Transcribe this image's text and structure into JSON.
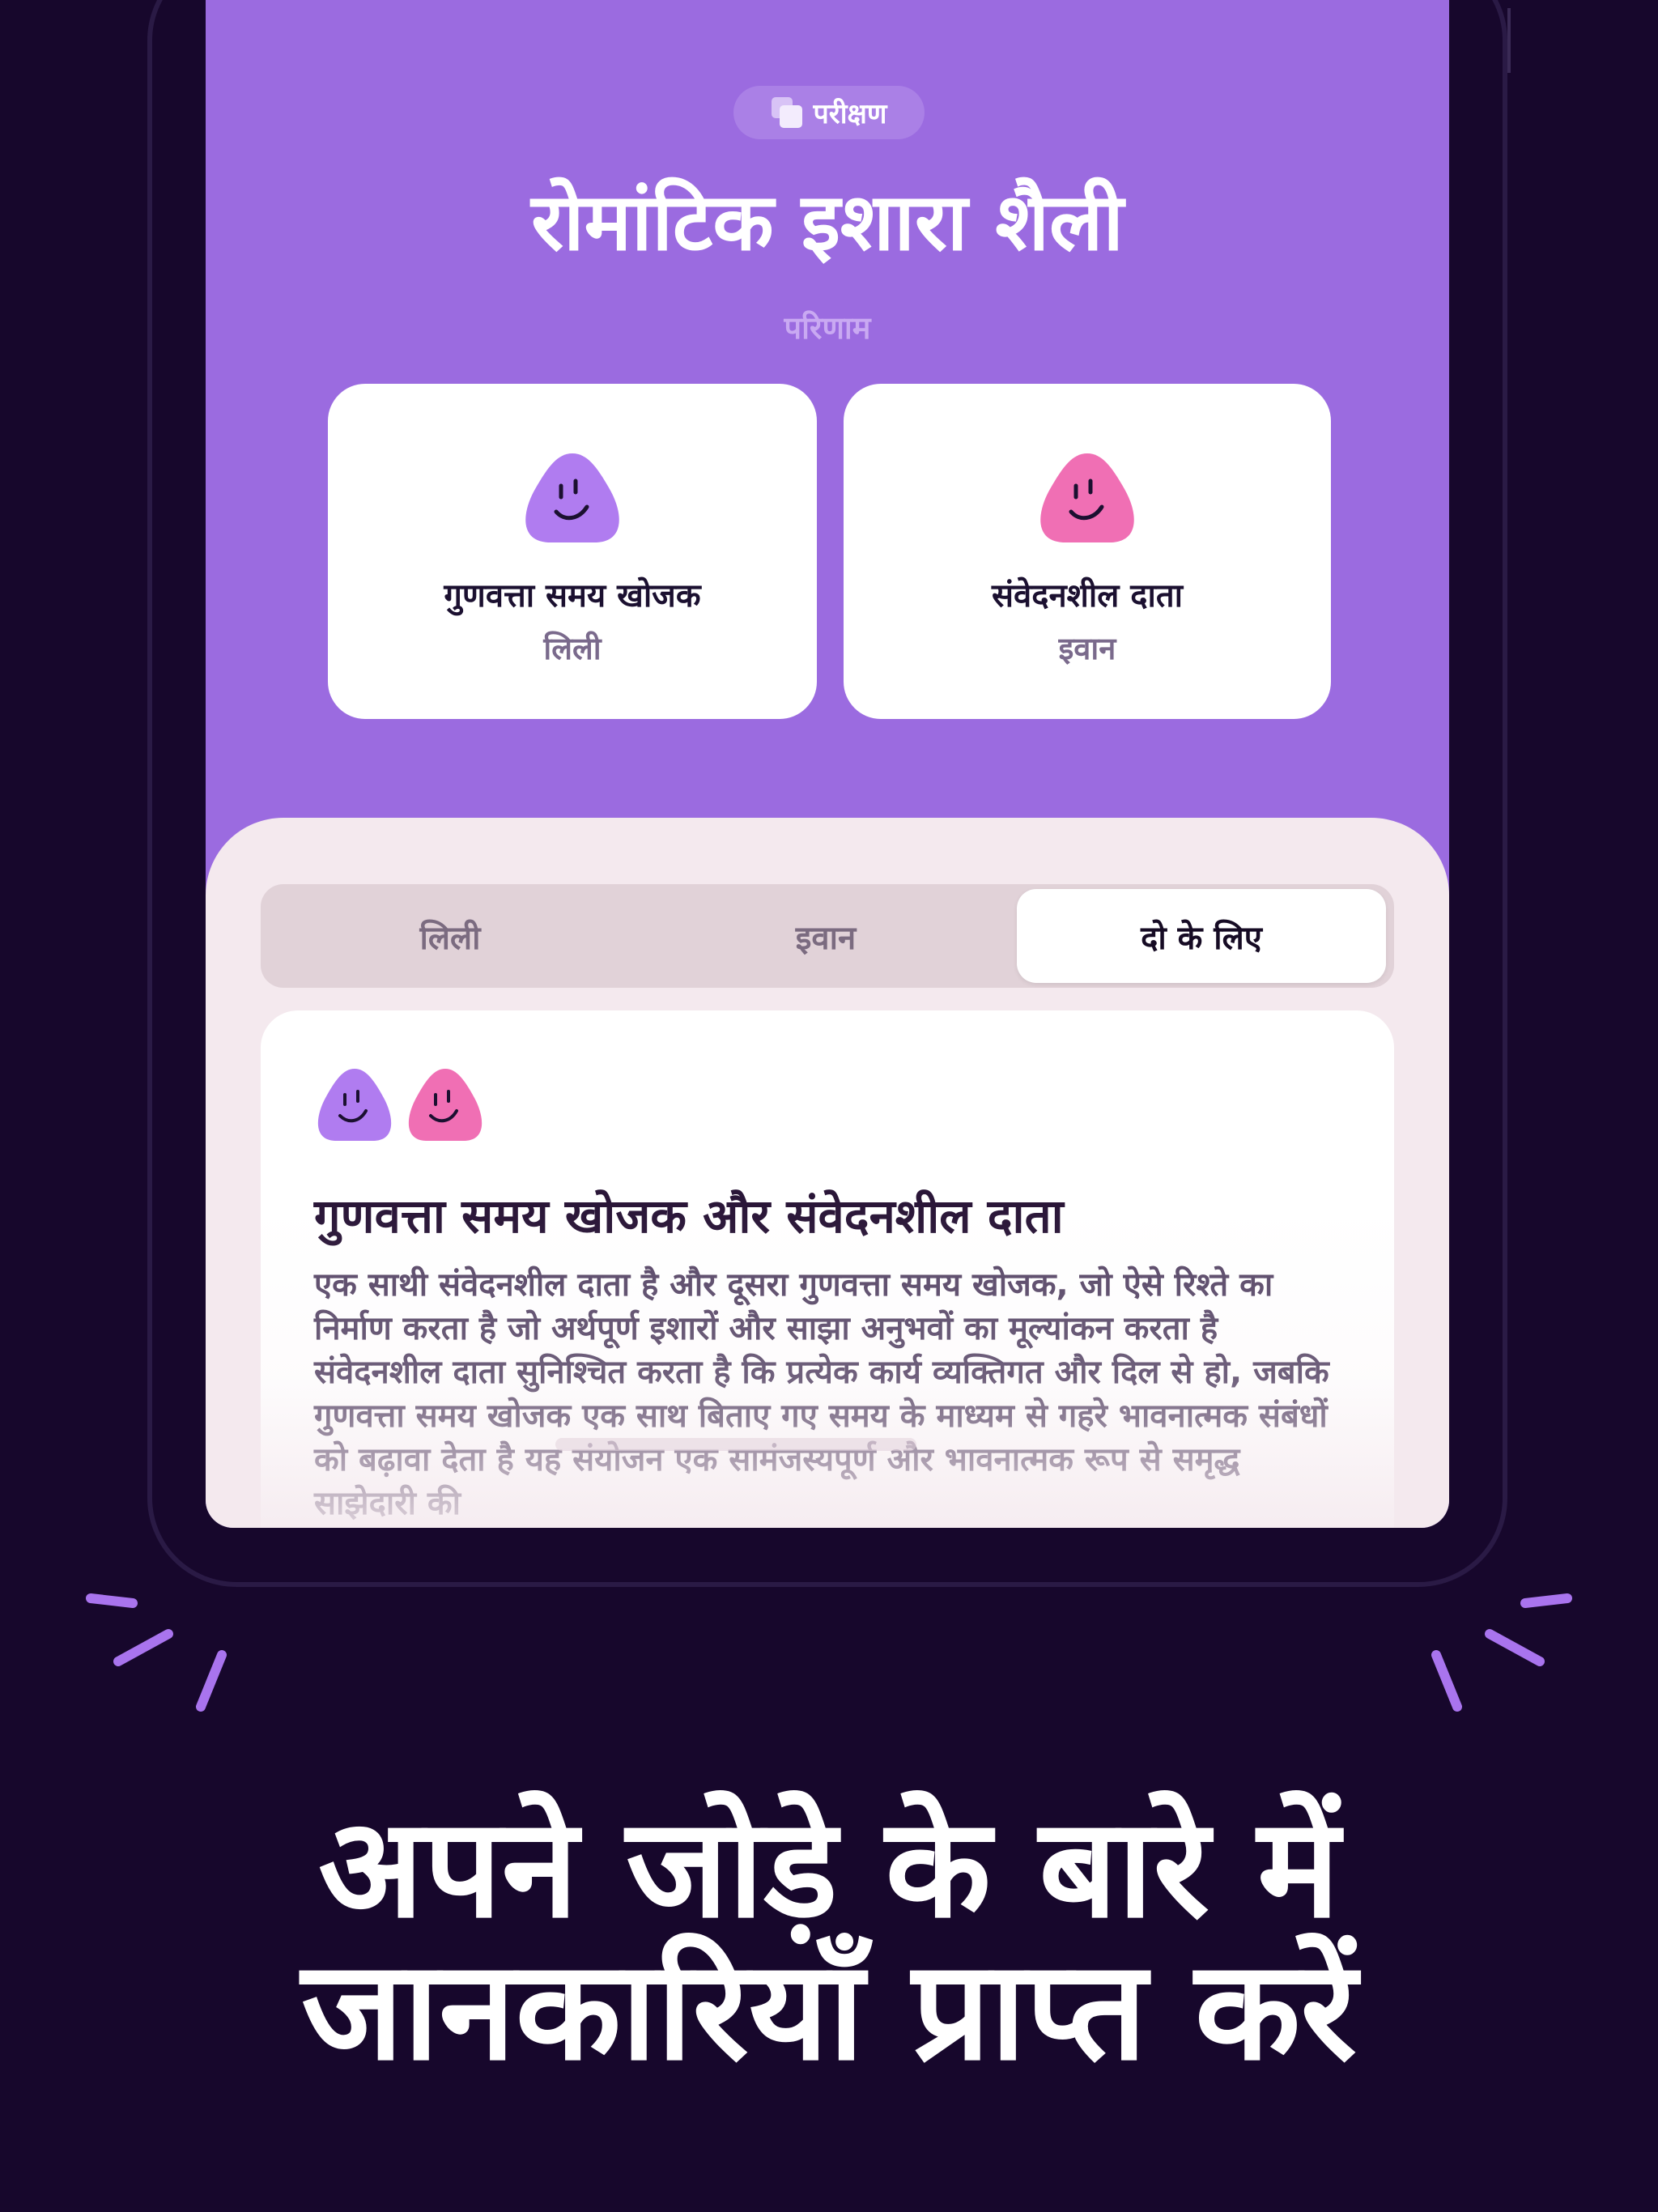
{
  "quiz": {
    "badge_label": "परीक्षण",
    "title": "रोमांटिक इशारा शैली",
    "results_label": "परिणाम"
  },
  "results": [
    {
      "type": "गुणवत्ता समय खोजक",
      "person": "लिली",
      "blob_color": "#b07cf0"
    },
    {
      "type": "संवेदनशील दाता",
      "person": "इवान",
      "blob_color": "#f06fb4"
    }
  ],
  "tabs": [
    {
      "label": "लिली",
      "selected": false
    },
    {
      "label": "इवान",
      "selected": false
    },
    {
      "label": "दो के लिए",
      "selected": true
    }
  ],
  "detail": {
    "title": "गुणवत्ता समय खोजक और संवेदनशील दाता",
    "body": "एक साथी संवेदनशील दाता है और दूसरा गुणवत्ता समय खोजक, जो ऐसे रिश्ते का निर्माण करता है जो अर्थपूर्ण इशारों और साझा अनुभवों का मूल्यांकन करता है  संवेदनशील दाता सुनिश्चित करता है कि प्रत्येक कार्य व्यक्तिगत और दिल से हो, जबकि गुणवत्ता समय खोजक एक साथ बिताए गए समय के माध्यम से गहरे भावनात्मक संबंधों को बढ़ावा देता है  यह संयोजन एक सामंजस्यपूर्ण और भावनात्मक रूप से समृद्ध साझेदारी की"
  },
  "promo": {
    "headline_line1": "अपने जोड़े के बारे में",
    "headline_line2": "जानकारियाँ प्राप्त करें"
  },
  "colors": {
    "background": "#17072c",
    "header_purple": "#9b6be0",
    "panel": "#f4e9ee",
    "accent_lines": "#a974ee"
  }
}
